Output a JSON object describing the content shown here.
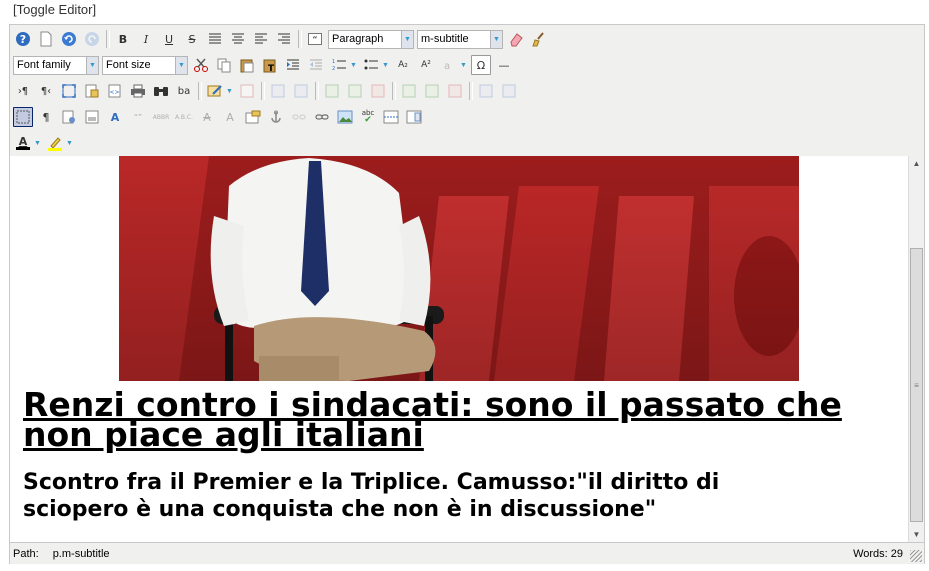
{
  "toggle_link": "[Toggle Editor]",
  "toolbar": {
    "row1": {
      "help": "?",
      "new": "▭",
      "undo": "↶",
      "redo": "↷",
      "bold": "B",
      "italic": "I",
      "underline": "U",
      "strike": "S",
      "justify_full": "≣",
      "justify_center": "≡",
      "justify_left": "≡",
      "justify_right": "≡",
      "blockquote": "❝",
      "format_select": "Paragraph",
      "style_select": "m-subtitle",
      "eraser": "⌫",
      "cleanup": "✎"
    },
    "row2": {
      "font_family": "Font family",
      "font_size": "Font size",
      "cut": "✂",
      "copy": "⎘",
      "paste": "📋",
      "paste_text": "T",
      "indent": "⇥",
      "outdent": "⇤",
      "numlist": "1.",
      "bullist": "•",
      "subscript": "A₂",
      "superscript": "A²",
      "charmap": "Ω",
      "hr": "—"
    },
    "row3": {
      "ltr": "¶",
      "rtl": "¶",
      "fullscreen": "⛶",
      "template": "▤",
      "code": "⟨⟩",
      "print": "⎙",
      "search": "🔍",
      "replace": "ba"
    },
    "row4": {
      "visualaid": "⬚",
      "pilcrow": "¶",
      "a_color": "A",
      "abbr": "ABBR",
      "link": "⚓",
      "spellcheck": "abc"
    }
  },
  "content": {
    "headline": " Renzi contro i sindacati: sono il passato che non piace agli italiani",
    "subtitle": "Scontro fra il Premier e la Triplice. Camusso:\"il diritto di sciopero è una conquista che non è in discussione\""
  },
  "status": {
    "path_label": "Path:",
    "path_value": "p.m-subtitle",
    "words": "Words: 29"
  },
  "colors": {
    "toolbar_bg": "#f0f0ee",
    "text_color_swatch": "#000000",
    "highlight_swatch": "#ffff00"
  }
}
